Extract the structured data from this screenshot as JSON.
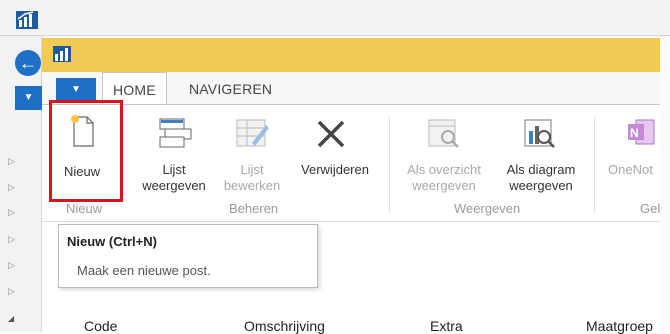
{
  "tabs": [
    "HOME",
    "NAVIGEREN"
  ],
  "ribbon": {
    "new": "Nieuw",
    "list_view": [
      "Lijst",
      "weergeven"
    ],
    "list_edit": [
      "Lijst",
      "bewerken"
    ],
    "delete": "Verwijderen",
    "as_overview": [
      "Als overzicht",
      "weergeven"
    ],
    "as_chart": [
      "Als diagram",
      "weergeven"
    ],
    "onenote": "OneNot",
    "groups": [
      "Nieuw",
      "Beheren",
      "Weergeven",
      "Gel"
    ]
  },
  "tooltip": {
    "title": "Nieuw (Ctrl+N)",
    "body": "Maak een nieuwe post."
  },
  "columns": [
    "Code",
    "Omschrijving",
    "Extra",
    "Maatgroep"
  ],
  "icons": [
    "app-logo-icon",
    "back-arrow-icon",
    "new-document-icon",
    "list-view-icon",
    "list-edit-icon",
    "delete-x-icon",
    "overview-icon",
    "chart-icon",
    "onenote-icon"
  ],
  "colors": {
    "accent": "#1f6fc4",
    "title_bar": "#f3ca53",
    "highlight": "#d9141e"
  }
}
